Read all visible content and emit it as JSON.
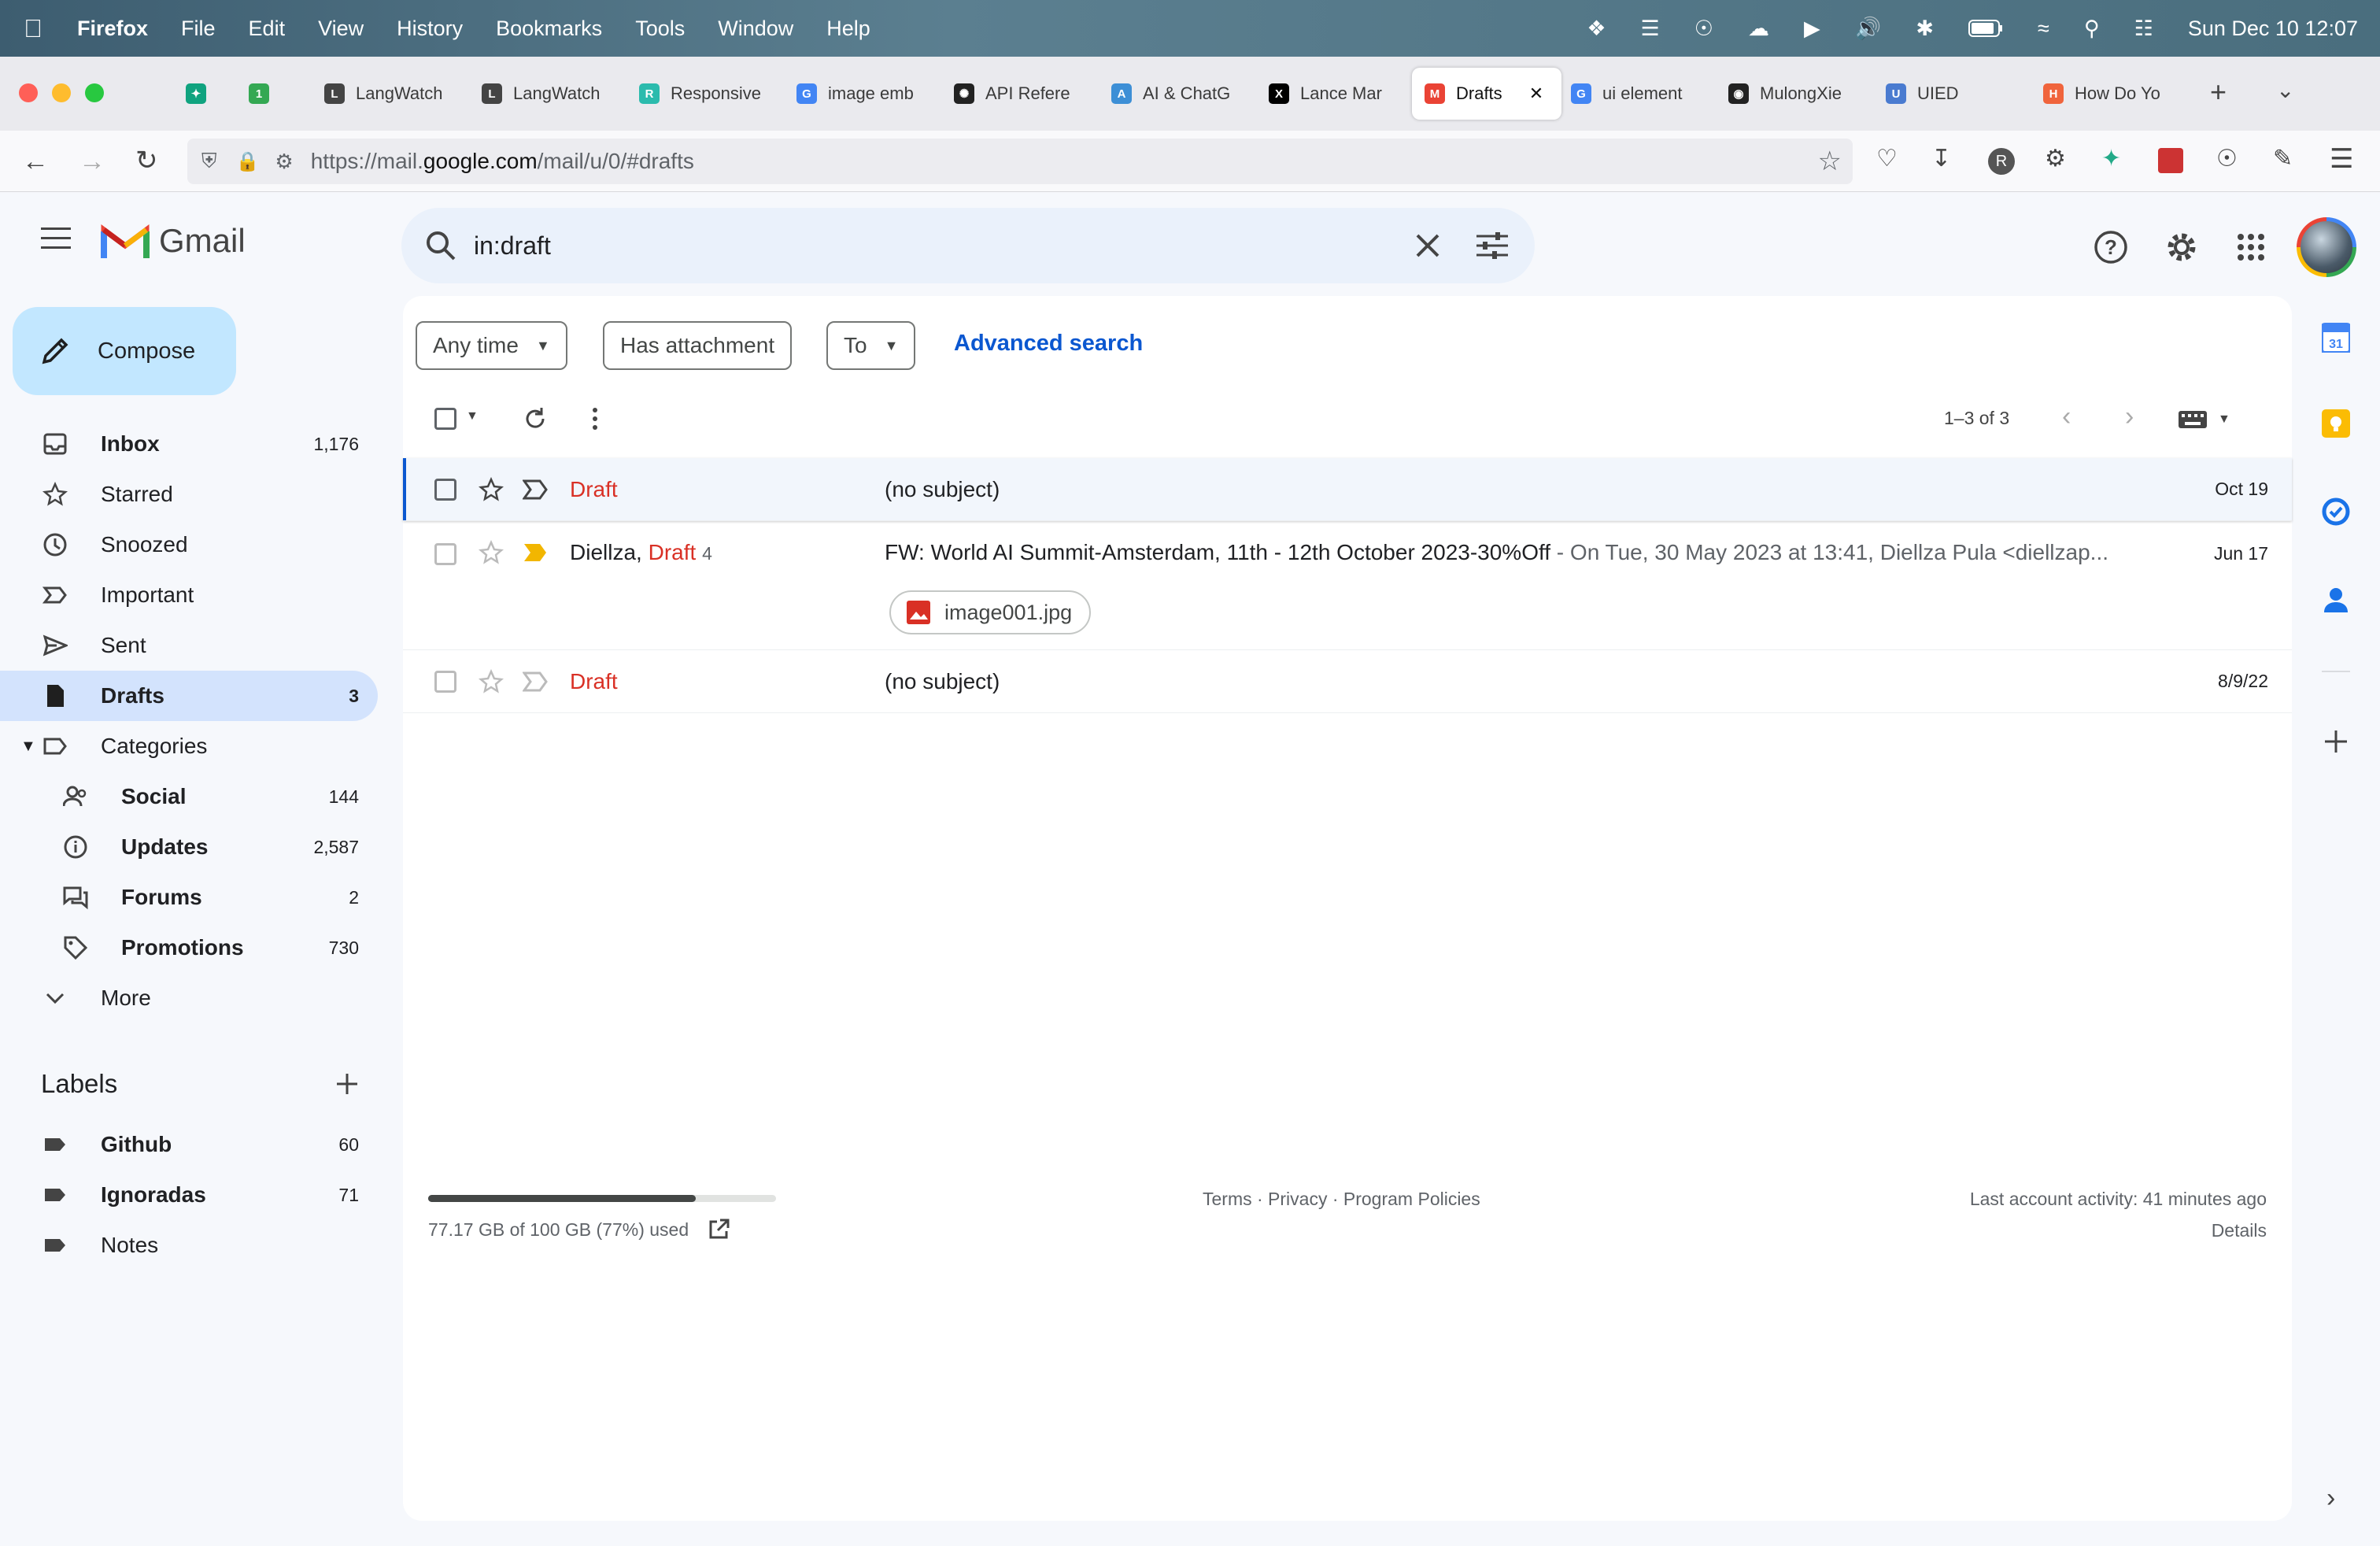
{
  "menubar": {
    "app": "Firefox",
    "items": [
      "File",
      "Edit",
      "View",
      "History",
      "Bookmarks",
      "Tools",
      "Window",
      "Help"
    ],
    "datetime": "Sun Dec 10 12:07"
  },
  "tabs": [
    {
      "label": "",
      "color": "#10a37f",
      "glyph": "✦"
    },
    {
      "label": "",
      "color": "#34a853",
      "glyph": "1"
    },
    {
      "label": "LangWatch",
      "color": "#444",
      "glyph": "L"
    },
    {
      "label": "LangWatch",
      "color": "#444",
      "glyph": "L"
    },
    {
      "label": "Responsive",
      "color": "#2bbbad",
      "glyph": "R"
    },
    {
      "label": "image emb",
      "color": "#4285f4",
      "glyph": "G"
    },
    {
      "label": "API Refere",
      "color": "#222",
      "glyph": "✺"
    },
    {
      "label": "AI & ChatG",
      "color": "#3d8fd6",
      "glyph": "A"
    },
    {
      "label": "Lance Mar",
      "color": "#000",
      "glyph": "X"
    },
    {
      "label": "Drafts",
      "color": "#ea4335",
      "glyph": "M"
    },
    {
      "label": "ui element",
      "color": "#4285f4",
      "glyph": "G"
    },
    {
      "label": "MulongXie",
      "color": "#222",
      "glyph": "◉"
    },
    {
      "label": "UIED",
      "color": "#4a7bd0",
      "glyph": "U"
    },
    {
      "label": "How Do Yo",
      "color": "#f0643c",
      "glyph": "H"
    }
  ],
  "navbar": {
    "url_prefix": "https://mail.",
    "url_domain": "google.com",
    "url_suffix": "/mail/u/0/#drafts",
    "profile_letter": "R"
  },
  "gmail": {
    "logo_text": "Gmail",
    "search_value": "in:draft",
    "compose_label": "Compose",
    "nav": [
      {
        "label": "Inbox",
        "count": "1,176",
        "bold": true
      },
      {
        "label": "Starred",
        "count": ""
      },
      {
        "label": "Snoozed",
        "count": ""
      },
      {
        "label": "Important",
        "count": ""
      },
      {
        "label": "Sent",
        "count": ""
      },
      {
        "label": "Drafts",
        "count": "3",
        "bold": true
      },
      {
        "label": "Categories",
        "count": ""
      }
    ],
    "categories": [
      {
        "label": "Social",
        "count": "144"
      },
      {
        "label": "Updates",
        "count": "2,587"
      },
      {
        "label": "Forums",
        "count": "2"
      },
      {
        "label": "Promotions",
        "count": "730"
      }
    ],
    "more_label": "More",
    "labels_title": "Labels",
    "labels": [
      {
        "label": "Github",
        "count": "60",
        "bold": true
      },
      {
        "label": "Ignoradas",
        "count": "71",
        "bold": true
      },
      {
        "label": "Notes",
        "count": ""
      }
    ],
    "filters": {
      "any_time": "Any time",
      "has_attachment": "Has attachment",
      "to": "To",
      "advanced": "Advanced search"
    },
    "pagination": "1–3 of 3",
    "emails": [
      {
        "sender": "",
        "draft": "Draft",
        "count": "",
        "subject": "(no subject)",
        "snippet": "",
        "date": "Oct 19"
      },
      {
        "sender": "Diellza, ",
        "draft": "Draft",
        "count": "4",
        "subject": "FW: World AI Summit-Amsterdam, 11th - 12th October 2023-30%Off",
        "snippet": " - On Tue, 30 May 2023 at 13:41, Diellza Pula <diellzap...",
        "date": "Jun 17",
        "attachment": "image001.jpg"
      },
      {
        "sender": "",
        "draft": "Draft",
        "count": "",
        "subject": "(no subject)",
        "snippet": "",
        "date": "8/9/22"
      }
    ],
    "storage": {
      "text": "77.17 GB of 100 GB (77%) used",
      "fraction": 0.77
    },
    "footer": {
      "terms": "Terms · Privacy · Program Policies",
      "activity": "Last account activity: 41 minutes ago",
      "details": "Details"
    }
  },
  "colors": {
    "accent": "#0b57d0",
    "compose_bg": "#c2e7ff",
    "selected_nav": "#d3e3fd",
    "draft_red": "#d93025"
  }
}
